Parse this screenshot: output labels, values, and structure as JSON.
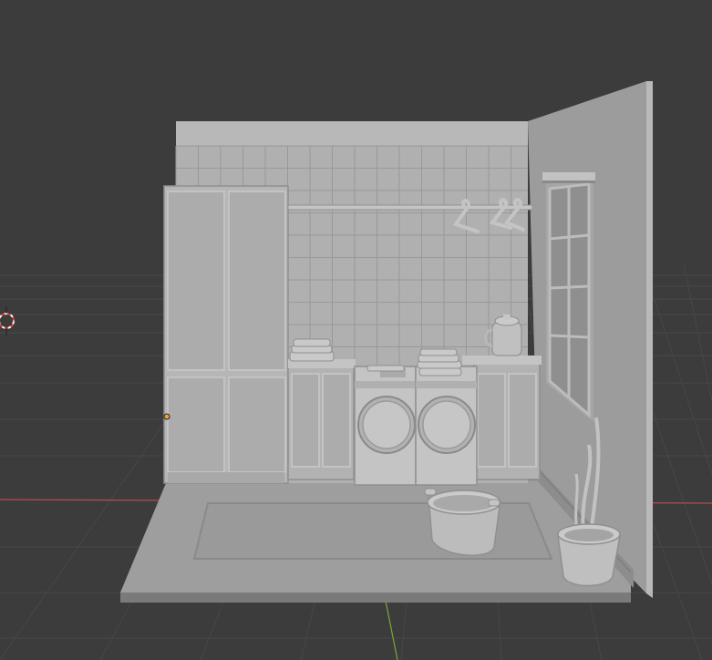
{
  "viewport": {
    "mode": "3d-viewport-solid-shading",
    "background_color": "#3c3c3c",
    "grid_color": "#4a4a4a",
    "x_axis_color": "#c4565a",
    "y_axis_color": "#8bc34a",
    "origin_marker_color": "#e8a33d"
  },
  "scene": {
    "material_color": "#b4b4b4",
    "objects": [
      "floor",
      "rug",
      "back-wall",
      "wall-tiles",
      "right-wall",
      "tall-cabinet",
      "base-cabinet-left",
      "base-cabinet-right",
      "washing-machine",
      "dryer",
      "folded-towels-left",
      "folded-towels-washer",
      "clothes-rail",
      "hanger",
      "hanger",
      "window",
      "jug",
      "laundry-basket",
      "potted-plant"
    ]
  }
}
